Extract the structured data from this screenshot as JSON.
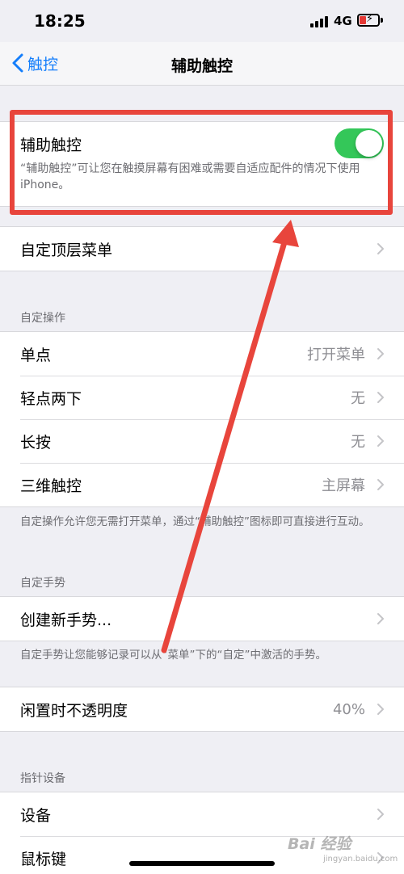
{
  "status_bar": {
    "time": "18:25",
    "network": "4G",
    "signal_icon": "cellular-signal-icon",
    "battery_icon": "battery-charging-icon"
  },
  "nav": {
    "back_label": "触控",
    "title": "辅助触控"
  },
  "assistive_touch": {
    "label": "辅助触控",
    "enabled": true,
    "description": "“辅助触控”可让您在触摸屏幕有困难或需要自适应配件的情况下使用 iPhone。"
  },
  "top_level_menu": {
    "label": "自定顶层菜单"
  },
  "custom_actions": {
    "header": "自定操作",
    "rows": [
      {
        "label": "单点",
        "value": "打开菜单"
      },
      {
        "label": "轻点两下",
        "value": "无"
      },
      {
        "label": "长按",
        "value": "无"
      },
      {
        "label": "三维触控",
        "value": "主屏幕"
      }
    ],
    "footer": "自定操作允许您无需打开菜单，通过“辅助触控”图标即可直接进行互动。"
  },
  "custom_gestures": {
    "header": "自定手势",
    "create_label": "创建新手势...",
    "footer": "自定手势让您能够记录可以从“菜单”下的“自定”中激活的手势。"
  },
  "idle_opacity": {
    "label": "闲置时不透明度",
    "value": "40%"
  },
  "pointer_devices": {
    "header": "指针设备",
    "rows": [
      {
        "label": "设备"
      },
      {
        "label": "鼠标键"
      }
    ]
  },
  "watermark": {
    "text": "Bai 经验",
    "sub": "jingyan.baidu.com"
  },
  "colors": {
    "accent": "#147efb",
    "toggle_on": "#34c759",
    "annotation": "#e8453c",
    "background": "#efeff4"
  }
}
